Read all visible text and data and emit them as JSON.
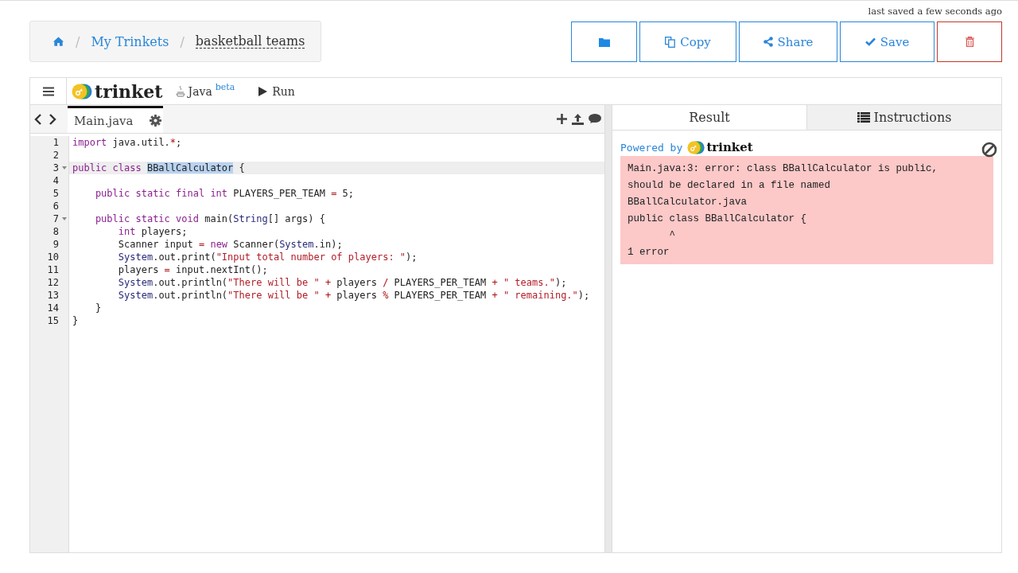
{
  "breadcrumb": {
    "separators": [
      "/",
      "/"
    ],
    "items": [
      {
        "kind": "home"
      },
      {
        "kind": "link",
        "label": "My Trinkets"
      },
      {
        "kind": "current",
        "label": "basketball teams"
      }
    ]
  },
  "status": "last saved a few seconds ago",
  "actions": [
    {
      "kind": "folder"
    },
    {
      "kind": "copy",
      "label": "Copy"
    },
    {
      "kind": "share",
      "label": "Share"
    },
    {
      "kind": "save",
      "label": "Save"
    },
    {
      "kind": "delete"
    }
  ],
  "toolbar": {
    "brand": "trinket",
    "language": "Java",
    "language_tag": "beta",
    "run": "Run"
  },
  "file_tab": {
    "label": "Main.java",
    "selected": true
  },
  "code": [
    {
      "n": "1",
      "active": false,
      "segs": [
        {
          "kind": "keyword",
          "t": "import"
        },
        {
          "kind": "plain",
          "t": " java.util."
        },
        {
          "kind": "operator",
          "t": "*"
        },
        {
          "kind": "plain",
          "t": ";"
        }
      ]
    },
    {
      "n": "2",
      "active": false
    },
    {
      "n": "3",
      "active": true,
      "fold": true,
      "segs": [
        {
          "kind": "keyword",
          "t": "public class "
        },
        {
          "kind": "selection",
          "t": "BBallCalculator"
        },
        {
          "kind": "plain",
          "t": " {"
        }
      ]
    },
    {
      "n": "4",
      "active": false
    },
    {
      "n": "5",
      "active": false,
      "segs": [
        {
          "kind": "keyword",
          "t": "    public static final int"
        },
        {
          "kind": "plain",
          "t": " PLAYERS_PER_TEAM "
        },
        {
          "kind": "operator",
          "t": "="
        },
        {
          "kind": "plain",
          "t": " 5;"
        }
      ]
    },
    {
      "n": "6",
      "active": false
    },
    {
      "n": "7",
      "active": false,
      "fold": true,
      "segs": [
        {
          "kind": "keyword",
          "t": "    public static void"
        },
        {
          "kind": "plain",
          "t": " main("
        },
        {
          "kind": "type",
          "t": "String"
        },
        {
          "kind": "plain",
          "t": "[] args) {"
        }
      ]
    },
    {
      "n": "8",
      "active": false,
      "segs": [
        {
          "kind": "keyword",
          "t": "        int"
        },
        {
          "kind": "plain",
          "t": " players;"
        }
      ]
    },
    {
      "n": "9",
      "active": false,
      "segs": [
        {
          "kind": "plain",
          "t": "        Scanner input "
        },
        {
          "kind": "operator",
          "t": "="
        },
        {
          "kind": "keyword",
          "t": " new"
        },
        {
          "kind": "plain",
          "t": " Scanner("
        },
        {
          "kind": "type",
          "t": "System"
        },
        {
          "kind": "plain",
          "t": ".in);"
        }
      ]
    },
    {
      "n": "10",
      "active": false,
      "segs": [
        {
          "kind": "type",
          "t": "        System"
        },
        {
          "kind": "plain",
          "t": ".out.print("
        },
        {
          "kind": "string",
          "t": "\"Input total number of players: \""
        },
        {
          "kind": "plain",
          "t": ");"
        }
      ]
    },
    {
      "n": "11",
      "active": false,
      "segs": [
        {
          "kind": "plain",
          "t": "        players "
        },
        {
          "kind": "operator",
          "t": "="
        },
        {
          "kind": "plain",
          "t": " input.nextInt();"
        }
      ]
    },
    {
      "n": "12",
      "active": false,
      "segs": [
        {
          "kind": "type",
          "t": "        System"
        },
        {
          "kind": "plain",
          "t": ".out.println("
        },
        {
          "kind": "string",
          "t": "\"There will be \""
        },
        {
          "kind": "operator",
          "t": " +"
        },
        {
          "kind": "plain",
          "t": " players "
        },
        {
          "kind": "operator",
          "t": "/"
        },
        {
          "kind": "plain",
          "t": " PLAYERS_PER_TEAM "
        },
        {
          "kind": "operator",
          "t": "+"
        },
        {
          "kind": "string",
          "t": " \" teams.\""
        },
        {
          "kind": "plain",
          "t": ");"
        }
      ]
    },
    {
      "n": "13",
      "active": false,
      "segs": [
        {
          "kind": "type",
          "t": "        System"
        },
        {
          "kind": "plain",
          "t": ".out.println("
        },
        {
          "kind": "string",
          "t": "\"There will be \""
        },
        {
          "kind": "operator",
          "t": " +"
        },
        {
          "kind": "plain",
          "t": " players "
        },
        {
          "kind": "operator",
          "t": "%"
        },
        {
          "kind": "plain",
          "t": " PLAYERS_PER_TEAM "
        },
        {
          "kind": "operator",
          "t": "+"
        },
        {
          "kind": "string",
          "t": " \" remaining.\""
        },
        {
          "kind": "plain",
          "t": ");"
        }
      ]
    },
    {
      "n": "14",
      "active": false,
      "segs": [
        {
          "kind": "plain",
          "t": "    }"
        }
      ]
    },
    {
      "n": "15",
      "active": false,
      "segs": [
        {
          "kind": "plain",
          "t": "}"
        }
      ]
    }
  ],
  "result_tabs": [
    {
      "kind": "result",
      "label": "Result",
      "selected": true
    },
    {
      "kind": "instructions",
      "label": "Instructions",
      "selected": false
    }
  ],
  "output": {
    "powered_by": "Powered by",
    "brand": "trinket",
    "error_lines": [
      "Main.java:3: error: class BBallCalculator is public,",
      "should be declared in a file named",
      "BBallCalculator.java",
      "public class BBallCalculator {",
      "       ^",
      "1 error"
    ]
  }
}
